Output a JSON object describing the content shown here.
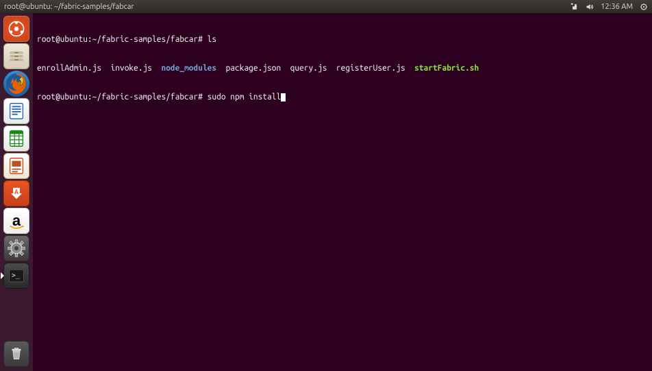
{
  "top_panel": {
    "title": "root@ubuntu: ~/fabric-samples/fabcar",
    "time": "12:36 AM"
  },
  "launcher": {
    "items": [
      {
        "name": "dash-icon",
        "label": "Dash"
      },
      {
        "name": "files-icon",
        "label": "Files"
      },
      {
        "name": "firefox-icon",
        "label": "Firefox"
      },
      {
        "name": "writer-icon",
        "label": "LibreOffice Writer"
      },
      {
        "name": "calc-icon",
        "label": "LibreOffice Calc"
      },
      {
        "name": "impress-icon",
        "label": "LibreOffice Impress"
      },
      {
        "name": "software-icon",
        "label": "Ubuntu Software"
      },
      {
        "name": "amazon-icon",
        "label": "Amazon"
      },
      {
        "name": "settings-icon",
        "label": "System Settings"
      },
      {
        "name": "terminal-icon",
        "label": "Terminal"
      },
      {
        "name": "trash-icon",
        "label": "Trash"
      }
    ]
  },
  "terminal": {
    "prompt1": "root@ubuntu:~/fabric-samples/fabcar#",
    "cmd1": "ls",
    "ls_output": {
      "items": [
        {
          "text": "enrollAdmin.js",
          "cls": "file-normal",
          "pad": 2
        },
        {
          "text": "invoke.js",
          "cls": "file-normal",
          "pad": 2
        },
        {
          "text": "node_modules",
          "cls": "file-dir",
          "pad": 2
        },
        {
          "text": "package.json",
          "cls": "file-normal",
          "pad": 2
        },
        {
          "text": "query.js",
          "cls": "file-normal",
          "pad": 2
        },
        {
          "text": "registerUser.js",
          "cls": "file-normal",
          "pad": 2
        },
        {
          "text": "startFabric.sh",
          "cls": "file-exec",
          "pad": 0
        }
      ]
    },
    "prompt2": "root@ubuntu:~/fabric-samples/fabcar#",
    "cmd2": "sudo npm install"
  }
}
